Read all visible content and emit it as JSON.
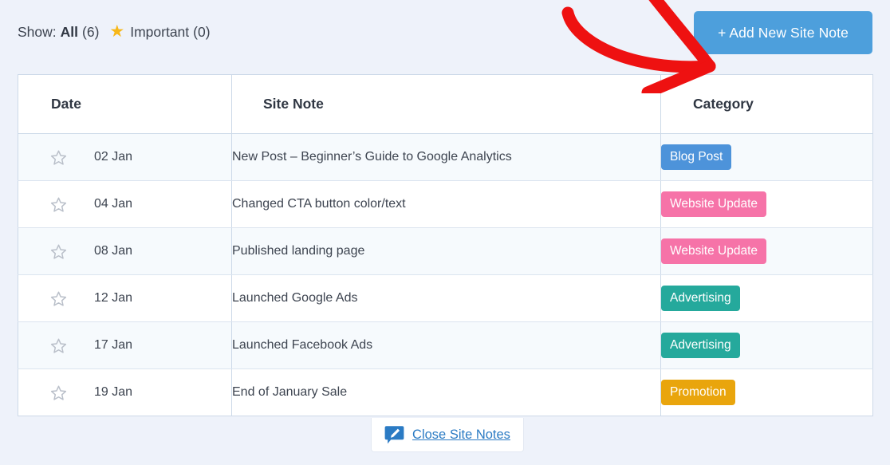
{
  "toolbar": {
    "show_label": "Show:",
    "all_label": "All",
    "all_count": "(6)",
    "star_icon": "star-filled-icon",
    "important_label": "Important",
    "important_count": "(0)",
    "add_button_label": "+ Add New Site Note",
    "add_button_color": "#4d9fdc"
  },
  "annotation": {
    "arrow_icon": "red-arrow-annotation",
    "arrow_color": "#ee1111"
  },
  "table": {
    "columns": [
      "Date",
      "Site Note",
      "Category"
    ],
    "rows": [
      {
        "star": "star-outline-icon",
        "date": "02 Jan",
        "note": "New Post – Beginner’s Guide to Google Analytics",
        "category": "Blog Post",
        "category_color": "#4d93da"
      },
      {
        "star": "star-outline-icon",
        "date": "04 Jan",
        "note": "Changed CTA button color/text",
        "category": "Website Update",
        "category_color": "#f673a8"
      },
      {
        "star": "star-outline-icon",
        "date": "08 Jan",
        "note": "Published landing page",
        "category": "Website Update",
        "category_color": "#f673a8"
      },
      {
        "star": "star-outline-icon",
        "date": "12 Jan",
        "note": "Launched Google Ads",
        "category": "Advertising",
        "category_color": "#25a99c"
      },
      {
        "star": "star-outline-icon",
        "date": "17 Jan",
        "note": "Launched Facebook Ads",
        "category": "Advertising",
        "category_color": "#25a99c"
      },
      {
        "star": "star-outline-icon",
        "date": "19 Jan",
        "note": "End of January Sale",
        "category": "Promotion",
        "category_color": "#e9a50d"
      }
    ]
  },
  "footer": {
    "note_icon": "note-pencil-icon",
    "close_label": "Close Site Notes",
    "link_color": "#2b7bc4"
  }
}
